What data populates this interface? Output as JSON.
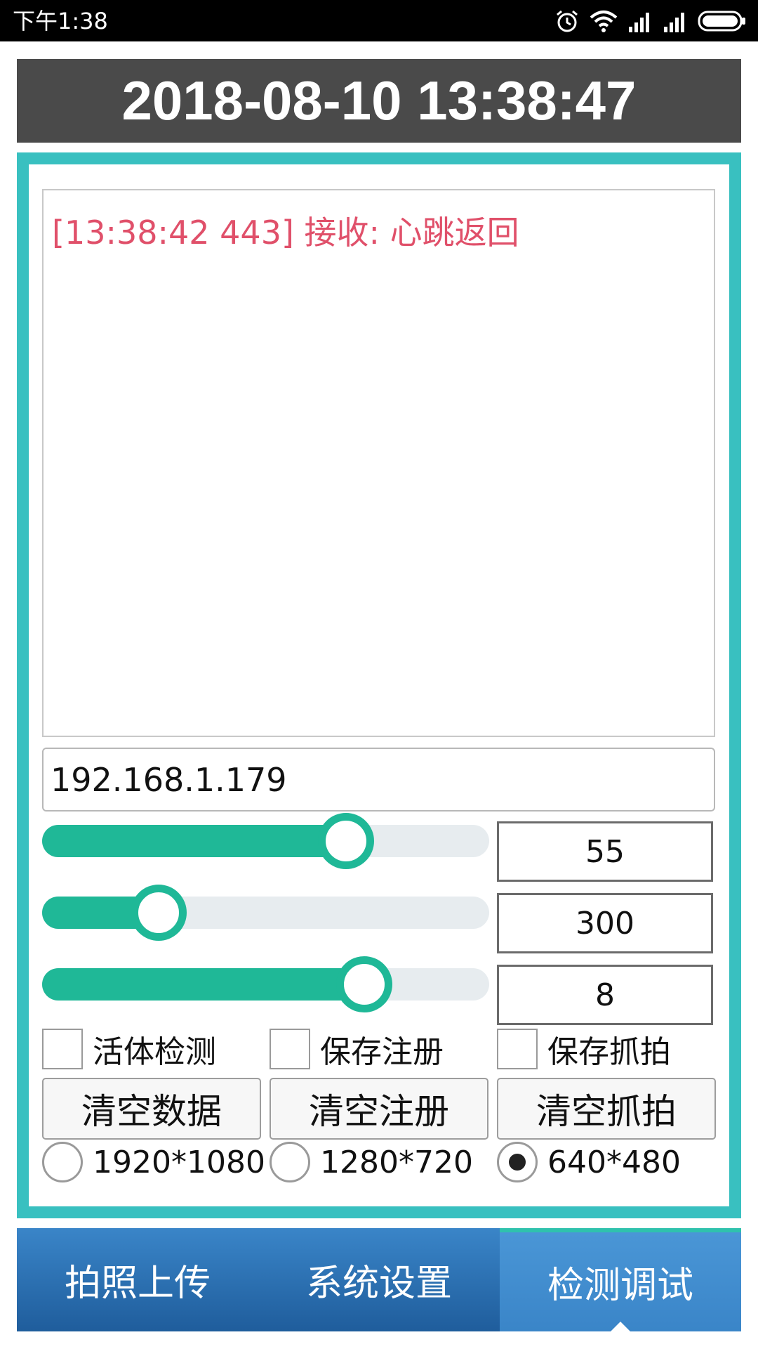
{
  "status_bar": {
    "time": "下午1:38",
    "icons": [
      "alarm-icon",
      "wifi-icon",
      "signal-icon",
      "signal-icon",
      "battery-icon"
    ]
  },
  "header": {
    "datetime": "2018-08-10 13:38:47"
  },
  "log": {
    "line": "[13:38:42 443] 接收: 心跳返回",
    "color": "#e0506a"
  },
  "ip_field": {
    "value": "192.168.1.179"
  },
  "sliders": [
    {
      "value_text": "55",
      "fraction": 0.68
    },
    {
      "value_text": "300",
      "fraction": 0.26
    },
    {
      "value_text": "8",
      "fraction": 0.72
    }
  ],
  "checkboxes": [
    {
      "label": "活体检测",
      "checked": false
    },
    {
      "label": "保存注册",
      "checked": false
    },
    {
      "label": "保存抓拍",
      "checked": false
    }
  ],
  "buttons": [
    {
      "label": "清空数据"
    },
    {
      "label": "清空注册"
    },
    {
      "label": "清空抓拍"
    }
  ],
  "resolutions": [
    {
      "label": "1920*1080",
      "selected": false
    },
    {
      "label": "1280*720",
      "selected": false
    },
    {
      "label": "640*480",
      "selected": true
    }
  ],
  "tabs": [
    {
      "label": "拍照上传",
      "active": false
    },
    {
      "label": "系统设置",
      "active": false
    },
    {
      "label": "检测调试",
      "active": true
    }
  ],
  "colors": {
    "accent_teal": "#39c0c0",
    "slider_green": "#1fb897",
    "header_bg": "#4a4a4a",
    "tab_blue": "#2a6fb2"
  }
}
